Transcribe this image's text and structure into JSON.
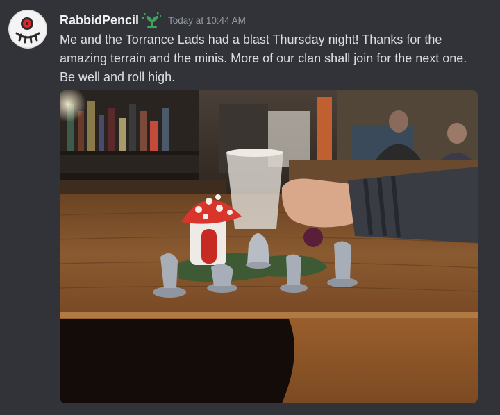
{
  "message": {
    "author": {
      "username": "RabbidPencil",
      "avatar_icon": "white-skull-face-red-eye-avatar",
      "role_icon": "green-sprout-icon",
      "name_color": "#f2f3f5"
    },
    "timestamp": "Today at 10:44 AM",
    "content": "Me and the Torrance Lads had a blast Thursday night! Thanks for the amazing terrain and the minis. More of our clan shall join for the next one. Be well and roll high.",
    "attachment": {
      "type": "image",
      "depicts": "painted tabletop miniatures and a mushroom house on a wooden bar counter"
    }
  },
  "theme": {
    "background": "#313338",
    "text": "#dbdee1",
    "muted": "#949ba4",
    "accent_green": "#3ba55c"
  }
}
